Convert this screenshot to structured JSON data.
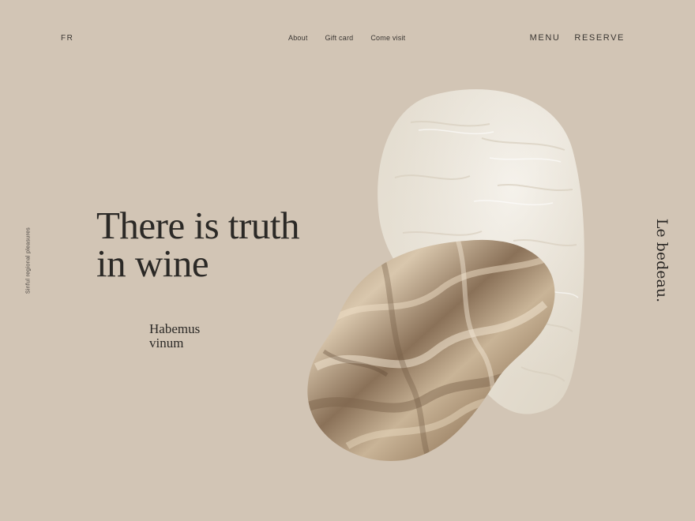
{
  "nav": {
    "lang": "FR",
    "links": [
      {
        "label": "About"
      },
      {
        "label": "Gift card"
      },
      {
        "label": "Come visit"
      }
    ],
    "menu": "MENU",
    "reserve": "RESERVE"
  },
  "side": {
    "left_tagline": "Sinful regional pleasures",
    "brand": "Le bedeau."
  },
  "hero": {
    "headline_line1": "There is truth",
    "headline_line2": "in wine",
    "sub_line1": "Habemus",
    "sub_line2": "vinum"
  },
  "colors": {
    "background": "#d2c5b5",
    "text": "#2d2a27",
    "plaster": "#ebe5d9",
    "silk": "#b8a184"
  }
}
